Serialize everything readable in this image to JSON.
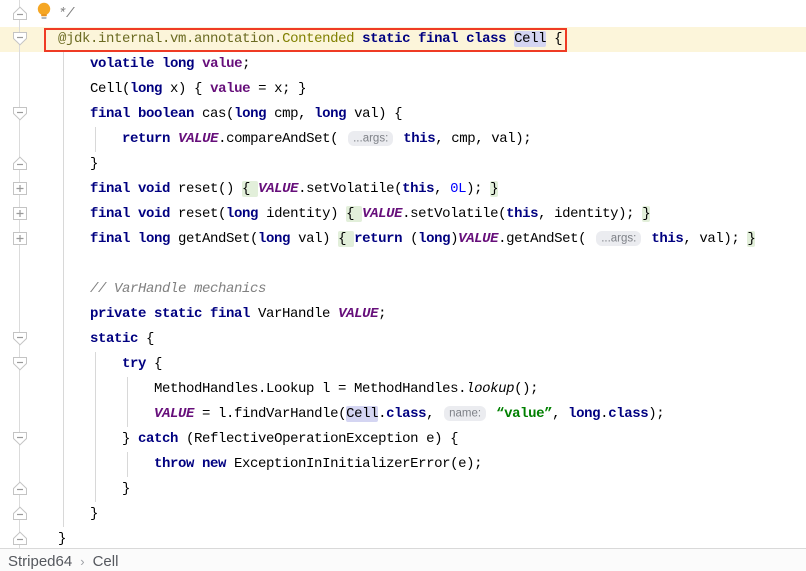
{
  "breadcrumbs": {
    "items": [
      "Striped64",
      "Cell"
    ],
    "separator": "›"
  },
  "colors": {
    "keyword": "#000080",
    "field": "#660E7A",
    "annotation": "#808000",
    "comment": "#808080",
    "string": "#008000",
    "number": "#0000FF",
    "caret_row_background": "#FCF5DA",
    "folded_region_background": "#E2EFDA",
    "identifier_highlight_background": "#D4D5F2",
    "selection_box_border": "#EF3B24",
    "inlay_hint_background": "#EBECF0",
    "inlay_hint_text": "#7E8187",
    "lightbulb": "#F5A623"
  },
  "editor": {
    "caret_line": 2,
    "highlighted_identifier": "Cell",
    "inlay_hints": [
      "...args:",
      "name:"
    ],
    "lines": [
      {
        "seg": [
          [
            "cmt",
            "    */"
          ]
        ]
      },
      {
        "seg": [
          [
            "plain",
            "    "
          ],
          [
            "annp",
            "@jdk.internal.vm.annotation."
          ],
          [
            "ann",
            "Contended"
          ],
          [
            "plain",
            " "
          ],
          [
            "kw",
            "static final class"
          ],
          [
            "plain",
            " "
          ],
          [
            "hlid",
            "Cell"
          ],
          [
            "plain",
            " {"
          ]
        ]
      },
      {
        "seg": [
          [
            "plain",
            "        "
          ],
          [
            "kw",
            "volatile long"
          ],
          [
            "plain",
            " "
          ],
          [
            "field",
            "value"
          ],
          [
            "plain",
            ";"
          ]
        ]
      },
      {
        "seg": [
          [
            "plain",
            "        Cell("
          ],
          [
            "kw",
            "long"
          ],
          [
            "plain",
            " x) { "
          ],
          [
            "field",
            "value"
          ],
          [
            "plain",
            " = x; }"
          ]
        ]
      },
      {
        "seg": [
          [
            "plain",
            "        "
          ],
          [
            "kw",
            "final boolean"
          ],
          [
            "plain",
            " cas("
          ],
          [
            "kw",
            "long"
          ],
          [
            "plain",
            " cmp, "
          ],
          [
            "kw",
            "long"
          ],
          [
            "plain",
            " val) {"
          ]
        ]
      },
      {
        "seg": [
          [
            "plain",
            "            "
          ],
          [
            "kw",
            "return"
          ],
          [
            "plain",
            " "
          ],
          [
            "sfield",
            "VALUE"
          ],
          [
            "plain",
            ".compareAndSet( "
          ],
          [
            "inlay",
            "...args:"
          ],
          [
            "plain",
            " "
          ],
          [
            "kw",
            "this"
          ],
          [
            "plain",
            ", cmp, val);"
          ]
        ]
      },
      {
        "seg": [
          [
            "plain",
            "        }"
          ]
        ]
      },
      {
        "seg": [
          [
            "plain",
            "        "
          ],
          [
            "kw",
            "final void"
          ],
          [
            "plain",
            " reset() "
          ],
          [
            "fold",
            "{ "
          ],
          [
            "sfield",
            "VALUE"
          ],
          [
            "plain",
            ".setVolatile("
          ],
          [
            "kw",
            "this"
          ],
          [
            "plain",
            ", "
          ],
          [
            "num",
            "0L"
          ],
          [
            "plain",
            "); "
          ],
          [
            "fold",
            "}"
          ]
        ]
      },
      {
        "seg": [
          [
            "plain",
            "        "
          ],
          [
            "kw",
            "final void"
          ],
          [
            "plain",
            " reset("
          ],
          [
            "kw",
            "long"
          ],
          [
            "plain",
            " identity) "
          ],
          [
            "fold",
            "{ "
          ],
          [
            "sfield",
            "VALUE"
          ],
          [
            "plain",
            ".setVolatile("
          ],
          [
            "kw",
            "this"
          ],
          [
            "plain",
            ", identity); "
          ],
          [
            "fold",
            "}"
          ]
        ]
      },
      {
        "seg": [
          [
            "plain",
            "        "
          ],
          [
            "kw",
            "final long"
          ],
          [
            "plain",
            " getAndSet("
          ],
          [
            "kw",
            "long"
          ],
          [
            "plain",
            " val) "
          ],
          [
            "fold",
            "{ "
          ],
          [
            "kw",
            "return"
          ],
          [
            "plain",
            " ("
          ],
          [
            "kw",
            "long"
          ],
          [
            "plain",
            ")"
          ],
          [
            "sfield",
            "VALUE"
          ],
          [
            "plain",
            ".getAndSet( "
          ],
          [
            "inlay",
            "...args:"
          ],
          [
            "plain",
            " "
          ],
          [
            "kw",
            "this"
          ],
          [
            "plain",
            ", val); "
          ],
          [
            "fold",
            "}"
          ]
        ]
      },
      {
        "seg": []
      },
      {
        "seg": [
          [
            "plain",
            "        "
          ],
          [
            "cmt",
            "// VarHandle mechanics"
          ]
        ]
      },
      {
        "seg": [
          [
            "plain",
            "        "
          ],
          [
            "kw",
            "private static final"
          ],
          [
            "plain",
            " VarHandle "
          ],
          [
            "sfield",
            "VALUE"
          ],
          [
            "plain",
            ";"
          ]
        ]
      },
      {
        "seg": [
          [
            "plain",
            "        "
          ],
          [
            "kw",
            "static"
          ],
          [
            "plain",
            " {"
          ]
        ]
      },
      {
        "seg": [
          [
            "plain",
            "            "
          ],
          [
            "kw",
            "try"
          ],
          [
            "plain",
            " {"
          ]
        ]
      },
      {
        "seg": [
          [
            "plain",
            "                MethodHandles.Lookup l = MethodHandles."
          ],
          [
            "mcall",
            "lookup"
          ],
          [
            "plain",
            "();"
          ]
        ]
      },
      {
        "seg": [
          [
            "plain",
            "                "
          ],
          [
            "sfield",
            "VALUE"
          ],
          [
            "plain",
            " = l.findVarHandle("
          ],
          [
            "hlid",
            "Cell"
          ],
          [
            "plain",
            "."
          ],
          [
            "kw",
            "class"
          ],
          [
            "plain",
            ", "
          ],
          [
            "inlay",
            "name:"
          ],
          [
            "plain",
            " "
          ],
          [
            "str",
            "“value”"
          ],
          [
            "plain",
            ", "
          ],
          [
            "kw",
            "long"
          ],
          [
            "plain",
            "."
          ],
          [
            "kw",
            "class"
          ],
          [
            "plain",
            ");"
          ]
        ]
      },
      {
        "seg": [
          [
            "plain",
            "            } "
          ],
          [
            "kw",
            "catch"
          ],
          [
            "plain",
            " (ReflectiveOperationException e) {"
          ]
        ]
      },
      {
        "seg": [
          [
            "plain",
            "                "
          ],
          [
            "kw",
            "throw new"
          ],
          [
            "plain",
            " ExceptionInInitializerError(e);"
          ]
        ]
      },
      {
        "seg": [
          [
            "plain",
            "            }"
          ]
        ]
      },
      {
        "seg": [
          [
            "plain",
            "        }"
          ]
        ]
      },
      {
        "seg": [
          [
            "plain",
            "    }"
          ]
        ]
      }
    ],
    "fold_markers": [
      {
        "line": 1,
        "type": "fold-end"
      },
      {
        "line": 2,
        "type": "fold-start"
      },
      {
        "line": 5,
        "type": "fold-start"
      },
      {
        "line": 7,
        "type": "fold-end"
      },
      {
        "line": 8,
        "type": "collapsed"
      },
      {
        "line": 9,
        "type": "collapsed"
      },
      {
        "line": 10,
        "type": "collapsed"
      },
      {
        "line": 14,
        "type": "fold-start"
      },
      {
        "line": 15,
        "type": "fold-start"
      },
      {
        "line": 18,
        "type": "fold-start"
      },
      {
        "line": 20,
        "type": "fold-end"
      },
      {
        "line": 21,
        "type": "fold-end"
      },
      {
        "line": 22,
        "type": "fold-end"
      }
    ]
  }
}
